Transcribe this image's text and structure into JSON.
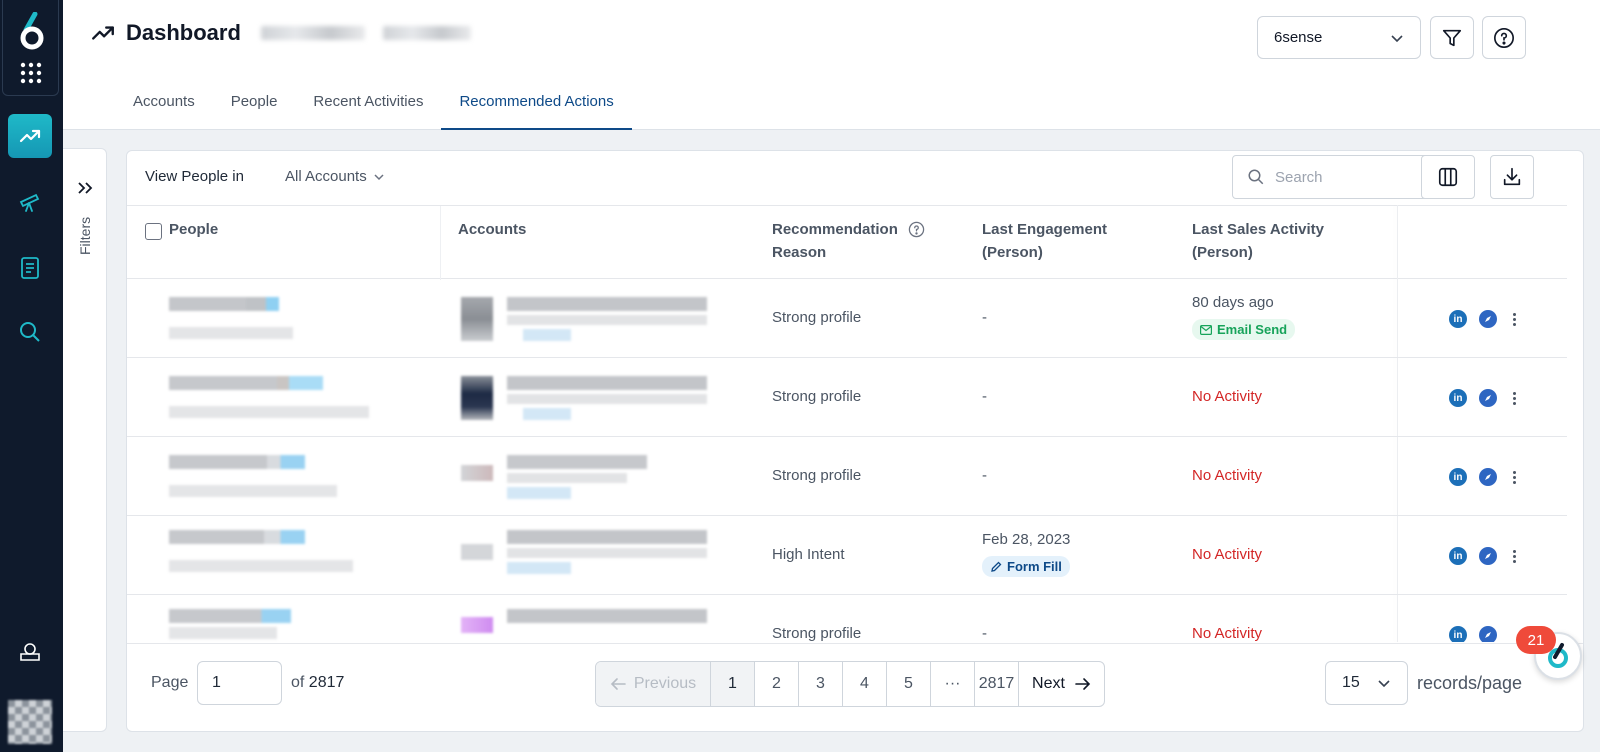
{
  "header": {
    "title": "Dashboard",
    "org_select": "6sense",
    "tabs": [
      {
        "label": "Accounts"
      },
      {
        "label": "People"
      },
      {
        "label": "Recent Activities"
      },
      {
        "label": "Recommended Actions"
      }
    ]
  },
  "filters": {
    "label": "Filters"
  },
  "toolbar": {
    "view_label": "View People in",
    "account_filter": "All Accounts",
    "search_placeholder": "Search"
  },
  "table": {
    "columns": {
      "people": "People",
      "accounts": "Accounts",
      "reason": "Recommendation Reason",
      "last_engagement": "Last Engagement (Person)",
      "last_sales": "Last Sales Activity (Person)"
    },
    "rows": [
      {
        "reason": "Strong profile",
        "engagement": "-",
        "engagement_chip": "",
        "sales": "80 days ago",
        "sales_chip": "Email Send"
      },
      {
        "reason": "Strong profile",
        "engagement": "-",
        "engagement_chip": "",
        "sales": "No Activity",
        "sales_chip": ""
      },
      {
        "reason": "Strong profile",
        "engagement": "-",
        "engagement_chip": "",
        "sales": "No Activity",
        "sales_chip": ""
      },
      {
        "reason": "High Intent",
        "engagement": "Feb 28, 2023",
        "engagement_chip": "Form Fill",
        "sales": "No Activity",
        "sales_chip": ""
      },
      {
        "reason": "Strong profile",
        "engagement": "-",
        "engagement_chip": "",
        "sales": "No Activity",
        "sales_chip": ""
      }
    ]
  },
  "pager": {
    "page_label": "Page",
    "current_page": "1",
    "of_label": "of",
    "total_pages": "2817",
    "previous": "Previous",
    "next": "Next",
    "pages": [
      "1",
      "2",
      "3",
      "4",
      "5",
      "···",
      "2817"
    ],
    "records_per_page": "15",
    "records_label": "records/page"
  },
  "chat": {
    "badge_count": "21"
  },
  "colors": {
    "brand_teal": "#1fb9c8",
    "active_tab": "#0e4a88",
    "no_activity": "#d32626"
  }
}
